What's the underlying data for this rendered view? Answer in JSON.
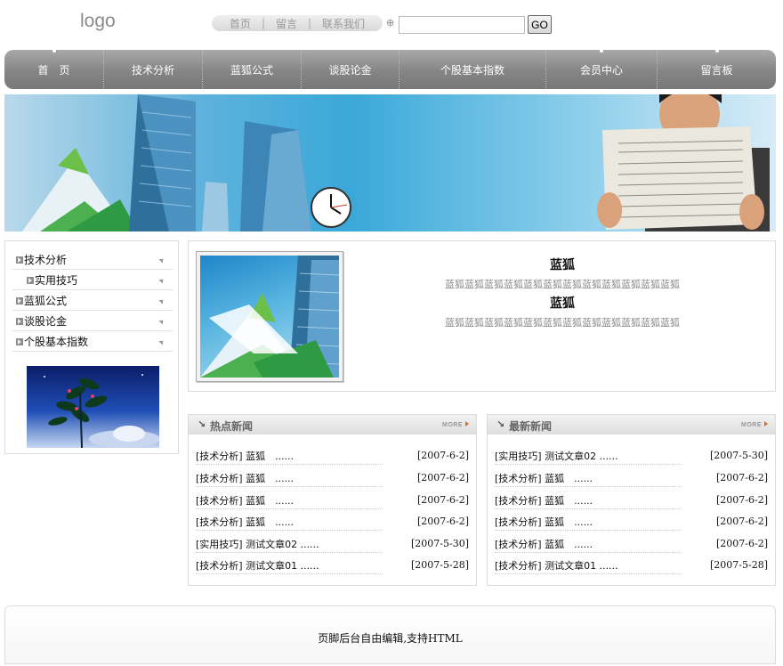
{
  "header": {
    "logo": "logo",
    "links": [
      "首页",
      "留言",
      "联系我们"
    ],
    "search": {
      "value": "",
      "placeholder": ""
    },
    "go_label": "GO"
  },
  "nav": {
    "items": [
      "首　页",
      "技术分析",
      "蓝狐公式",
      "谈股论金",
      "个股基本指数",
      "会员中心",
      "留言板"
    ]
  },
  "sidebar": {
    "items": [
      {
        "label": "技术分析",
        "sub": false
      },
      {
        "label": "实用技巧",
        "sub": true
      },
      {
        "label": "蓝狐公式",
        "sub": false
      },
      {
        "label": "谈股论金",
        "sub": false
      },
      {
        "label": "个股基本指数",
        "sub": false
      }
    ]
  },
  "feature": {
    "title1": "蓝狐",
    "text1": "蓝狐蓝狐蓝狐蓝狐蓝狐蓝狐蓝狐蓝狐蓝狐蓝狐蓝狐蓝狐",
    "title2": "蓝狐",
    "text2": "蓝狐蓝狐蓝狐蓝狐蓝狐蓝狐蓝狐蓝狐蓝狐蓝狐蓝狐蓝狐"
  },
  "hot_news": {
    "title": "热点新闻",
    "more": "MORE",
    "rows": [
      {
        "title": "[技术分析] 蓝狐　......",
        "date": "[2007-6-2]"
      },
      {
        "title": "[技术分析] 蓝狐　......",
        "date": "[2007-6-2]"
      },
      {
        "title": "[技术分析] 蓝狐　......",
        "date": "[2007-6-2]"
      },
      {
        "title": "[技术分析] 蓝狐　......",
        "date": "[2007-6-2]"
      },
      {
        "title": "[实用技巧] 测试文章02 ......",
        "date": "[2007-5-30]"
      },
      {
        "title": "[技术分析] 测试文章01 ......",
        "date": "[2007-5-28]"
      }
    ]
  },
  "latest_news": {
    "title": "最新新闻",
    "more": "MORE",
    "rows": [
      {
        "title": "[实用技巧] 测试文章02 ......",
        "date": "[2007-5-30]"
      },
      {
        "title": "[技术分析] 蓝狐　......",
        "date": "[2007-6-2]"
      },
      {
        "title": "[技术分析] 蓝狐　......",
        "date": "[2007-6-2]"
      },
      {
        "title": "[技术分析] 蓝狐　......",
        "date": "[2007-6-2]"
      },
      {
        "title": "[技术分析] 蓝狐　......",
        "date": "[2007-6-2]"
      },
      {
        "title": "[技术分析] 测试文章01 ......",
        "date": "[2007-5-28]"
      }
    ]
  },
  "footer": {
    "text": "页脚后台自由编辑,支持HTML"
  }
}
